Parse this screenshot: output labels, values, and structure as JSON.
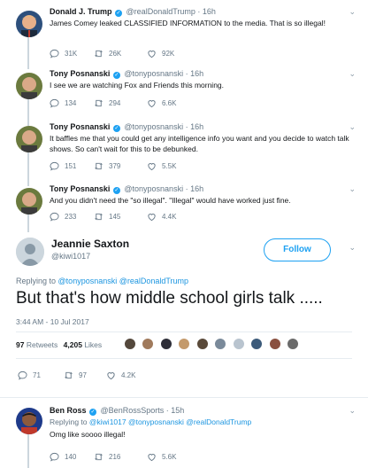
{
  "tweets": [
    {
      "name": "Donald J. Trump",
      "handle": "@realDonaldTrump",
      "time": "16h",
      "text": "James Comey leaked CLASSIFIED INFORMATION to the media. That is so illegal!",
      "replies": "31K",
      "retweets": "26K",
      "likes": "92K"
    },
    {
      "name": "Tony Posnanski",
      "handle": "@tonyposnanski",
      "time": "16h",
      "text": "I see we are watching Fox and Friends this morning.",
      "replies": "134",
      "retweets": "294",
      "likes": "6.6K"
    },
    {
      "name": "Tony Posnanski",
      "handle": "@tonyposnanski",
      "time": "16h",
      "text": "It baffles me that you could get any intelligence info you want and you decide to watch talk shows. So can't wait for this to be debunked.",
      "replies": "151",
      "retweets": "379",
      "likes": "5.5K"
    },
    {
      "name": "Tony Posnanski",
      "handle": "@tonyposnanski",
      "time": "16h",
      "text": "And you didn't need the \"so illegal\". \"Illegal\" would have worked just fine.",
      "replies": "233",
      "retweets": "145",
      "likes": "4.4K"
    }
  ],
  "main": {
    "name": "Jeannie Saxton",
    "handle": "@kiwi1017",
    "follow_label": "Follow",
    "replying_prefix": "Replying to",
    "replying_to": "@tonyposnanski @realDonaldTrump",
    "text": "But that's how middle school girls talk .....",
    "timestamp": "3:44 AM - 10 Jul 2017",
    "retweets_count": "97",
    "retweets_label": "Retweets",
    "likes_count": "4,205",
    "likes_label": "Likes",
    "replies": "71",
    "retweets": "97",
    "likes": "4.2K"
  },
  "reply": {
    "name": "Ben Ross",
    "handle": "@BenRossSports",
    "time": "15h",
    "replying_prefix": "Replying to",
    "replying_to": "@kiwi1017 @tonyposnanski @realDonaldTrump",
    "text": "Omg like soooo illegal!",
    "replies": "140",
    "retweets": "216",
    "likes": "5.6K"
  },
  "colors": {
    "accent": "#1da1f2",
    "link": "#1b95e0",
    "muted": "#657786",
    "divider": "#e6ecf0"
  },
  "icons": [
    "reply-icon",
    "retweet-icon",
    "like-icon",
    "verified-icon",
    "chevron-down-icon"
  ]
}
